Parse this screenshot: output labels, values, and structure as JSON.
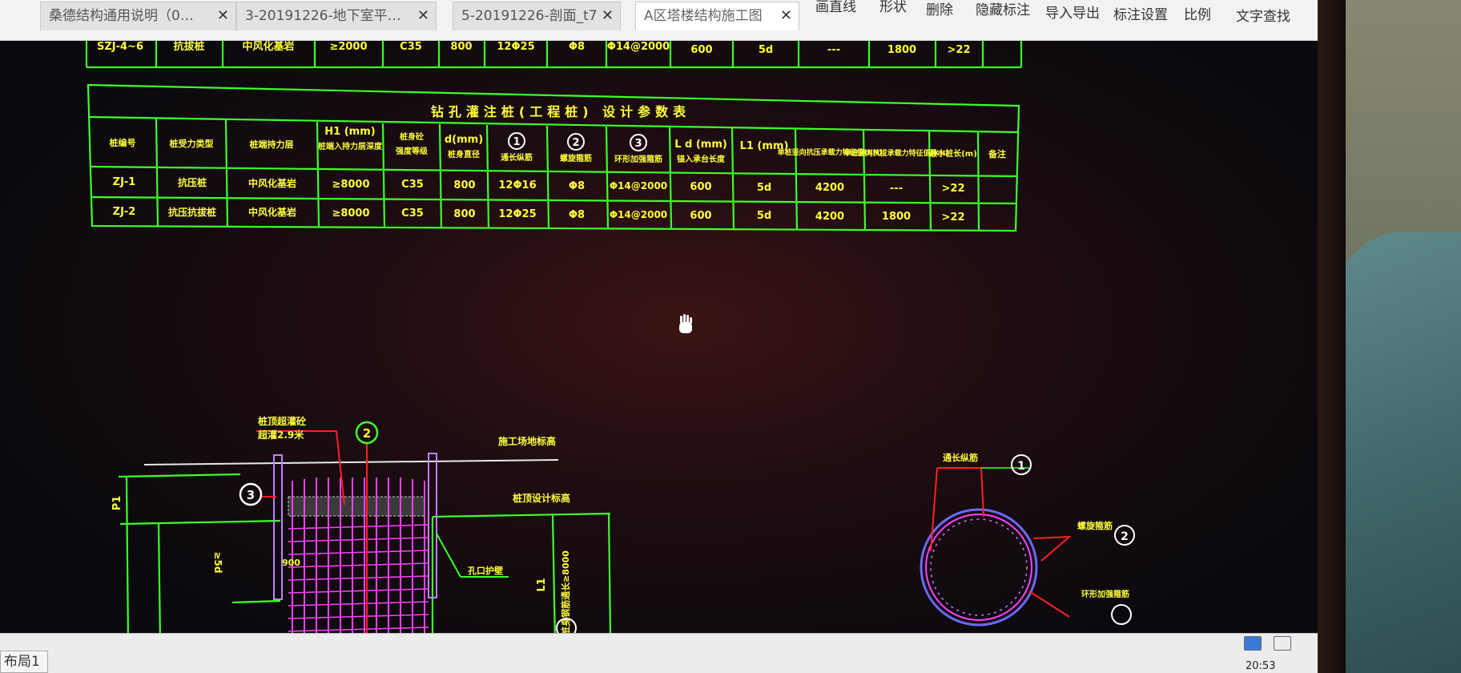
{
  "tabs": [
    {
      "label": "桑德结构通用说明（0…",
      "active": false
    },
    {
      "label": "3-20191226-地下室平…",
      "active": false
    },
    {
      "label": "5-20191226-剖面_t7",
      "active": false
    },
    {
      "label": "A区塔楼结构施工图",
      "active": true
    }
  ],
  "tab_close_glyph": "✕",
  "toolbar": [
    "画直线",
    "形状",
    "删除",
    "隐藏标注",
    "导入导出",
    "标注设置",
    "比例",
    "文字查找"
  ],
  "prev_table_row": [
    "SZJ-4~6",
    "抗拔桩",
    "中风化基岩",
    "≥2000",
    "C35",
    "800",
    "12Φ25",
    "Φ8",
    "Φ14@2000",
    "600",
    "5d",
    "---",
    "1800",
    ">22",
    ""
  ],
  "table": {
    "title": "钻孔灌注桩(工程桩) 设计参数表",
    "headers": [
      {
        "top": "",
        "bottom": "桩编号"
      },
      {
        "top": "",
        "bottom": "桩受力类型"
      },
      {
        "top": "",
        "bottom": "桩端持力层"
      },
      {
        "top": "H1 (mm)",
        "bottom": "桩端入持力层深度"
      },
      {
        "top": "桩身砼",
        "bottom": "强度等级"
      },
      {
        "top": "d(mm)",
        "bottom": "桩身直径"
      },
      {
        "top": "①",
        "bottom": "通长纵筋"
      },
      {
        "top": "②",
        "bottom": "螺旋箍筋"
      },
      {
        "top": "③",
        "bottom": "环形加强箍筋"
      },
      {
        "top": "L d (mm)",
        "bottom": "锚入承台长度"
      },
      {
        "top": "L1 (mm)",
        "bottom": ""
      },
      {
        "top": "",
        "bottom": "单桩竖向抗压承载力特征值(KN)"
      },
      {
        "top": "",
        "bottom": "单桩竖向抗拔承载力特征值(KN)"
      },
      {
        "top": "",
        "bottom": "最小桩长(m)"
      },
      {
        "top": "",
        "bottom": "备注"
      }
    ],
    "rows": [
      [
        "ZJ-1",
        "抗压桩",
        "中风化基岩",
        "≥8000",
        "C35",
        "800",
        "12Φ16",
        "Φ8",
        "Φ14@2000",
        "600",
        "5d",
        "4200",
        "---",
        ">22",
        ""
      ],
      [
        "ZJ-2",
        "抗压抗拔桩",
        "中风化基岩",
        "≥8000",
        "C35",
        "800",
        "12Φ25",
        "Φ8",
        "Φ14@2000",
        "600",
        "5d",
        "4200",
        "1800",
        ">22",
        ""
      ]
    ]
  },
  "drawing": {
    "label_construction_ground": "施工场地标高",
    "label_cap_bottom": "桩顶设计标高",
    "label_concrete_pour": "桩顶超灌砼",
    "label_pour_height": "超灌2.9米",
    "label_guard_wall": "孔口护壁",
    "label_dim_p1": "P1",
    "label_dim_l1": "L1",
    "label_left_dim": "≥5d",
    "label_anchor": "桩身钢筋通长≥8000",
    "circle_labels": [
      "①",
      "②",
      "③"
    ],
    "section_label_main": "通长纵筋",
    "section_label_spiral": "螺旋箍筋",
    "section_label_ring": "环形加强箍筋"
  },
  "status": {
    "layout_tab": "布局1",
    "clock": "20:53"
  },
  "colors": {
    "cad_line": "#3cff2a",
    "cad_text": "#ffff3a",
    "rebar": "#ff40ff",
    "leader": "#ff2020",
    "background": "#0a0a0e"
  }
}
